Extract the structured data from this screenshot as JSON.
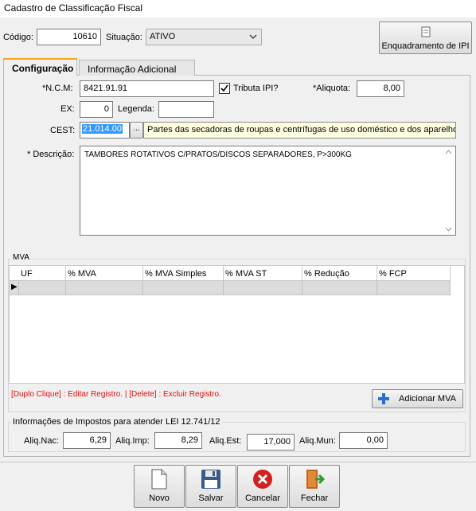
{
  "window": {
    "title": "Cadastro de Classificação Fiscal"
  },
  "header": {
    "codigo_label": "Código:",
    "codigo_value": "10610",
    "situacao_label": "Situação:",
    "situacao_value": "ATIVO",
    "enquadramento_label": "Enquadramento de IPI"
  },
  "tabs": [
    {
      "label": "Configuração",
      "active": true
    },
    {
      "label": "Informação Adicional",
      "active": false
    }
  ],
  "form": {
    "ncm_label": "*N.C.M:",
    "ncm_value": "8421.91.91",
    "tributa_ipi_label": "Tributa IPI?",
    "tributa_ipi_checked": true,
    "aliquota_label": "*Aliquota:",
    "aliquota_value": "8,00",
    "ex_label": "EX:",
    "ex_value": "0",
    "legenda_label": "Legenda:",
    "legenda_value": "",
    "cest_label": "CEST:",
    "cest_value": "21.014.00",
    "cest_lookup_label": "...",
    "cest_description": "Partes das secadoras de roupas e centrífugas de uso doméstico e dos aparelhos",
    "descricao_label": "* Descrição:",
    "descricao_value": "TAMBORES ROTATIVOS C/PRATOS/DISCOS SEPARADORES, P>300KG"
  },
  "mva": {
    "group_label": "MVA",
    "columns": [
      "UF",
      "% MVA",
      "% MVA Simples",
      "% MVA ST",
      "% Redução",
      "% FCP"
    ],
    "row_indicator": "▶",
    "hint": "[Duplo Clique] : Editar Registro.  |  [Delete] : Excluir Registro.",
    "add_button_label": "Adicionar MVA"
  },
  "impostos": {
    "group_label": "Informações de Impostos para atender LEI 12.741/12",
    "nac_label": "Aliq.Nac:",
    "nac_value": "6,29",
    "imp_label": "Aliq.Imp:",
    "imp_value": "8,29",
    "est_label": "Aliq.Est:",
    "est_value": "17,000",
    "mun_label": "Aliq.Mun:",
    "mun_value": "0,00"
  },
  "footer": {
    "novo": "Novo",
    "salvar": "Salvar",
    "cancelar": "Cancelar",
    "fechar": "Fechar"
  },
  "colors": {
    "hint_red": "#e01010",
    "tab_accent": "#f4a91c",
    "cest_tooltip_bg": "#ffffe1",
    "selection_blue": "#3399ff"
  },
  "icons": [
    "document-icon",
    "dropdown-chevron-icon",
    "checkbox-icon",
    "plus-icon",
    "new-document-icon",
    "floppy-disk-icon",
    "cancel-icon",
    "exit-door-icon"
  ]
}
